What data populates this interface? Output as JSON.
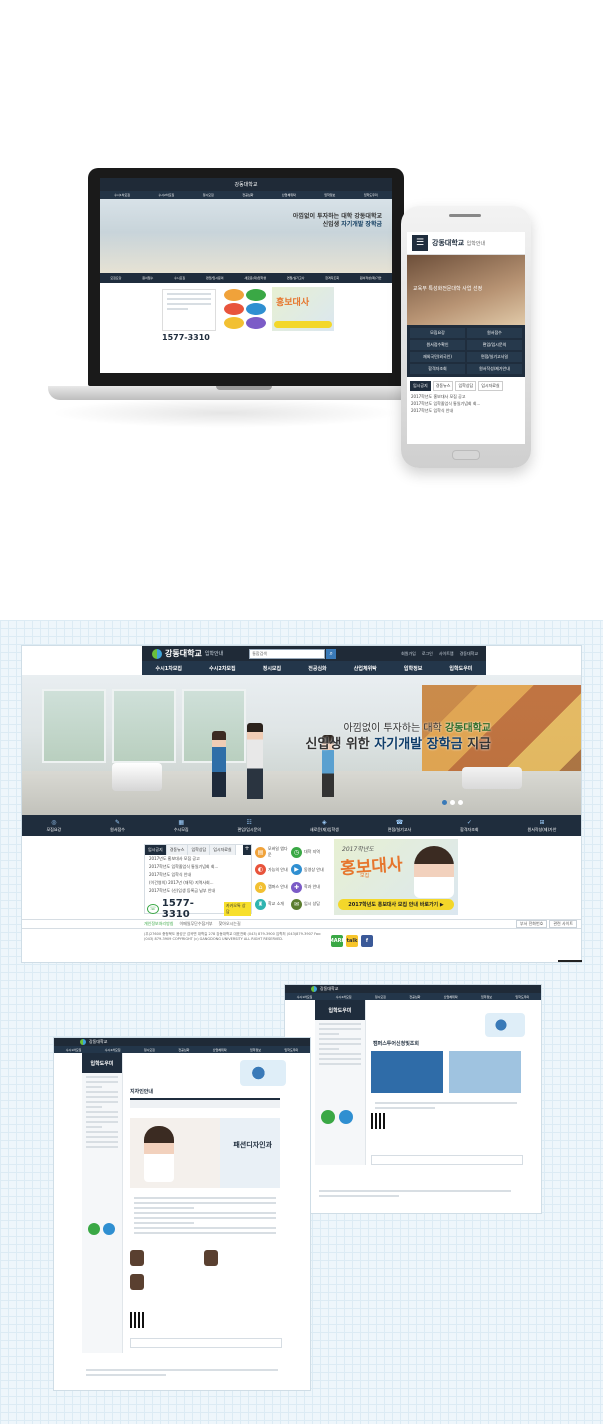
{
  "brand": {
    "name": "강동대학교",
    "sub": "입학안내"
  },
  "search": {
    "placeholder": "통합검색"
  },
  "util_links": [
    "회원가입",
    "로그인",
    "사이트맵",
    "경동대학교"
  ],
  "menu": [
    "수시1차모집",
    "수시2차모집",
    "정시모집",
    "전공심화",
    "산업체위탁",
    "입학정보",
    "입학도우미"
  ],
  "hero": {
    "line1_prefix": "아낌없이 투자하는 대학",
    "line1_highlight": "강동대학교",
    "line2_prefix": "신입생",
    "line2_mid": "위한",
    "line2_highlight": "자기개발 장학금",
    "line2_suffix": "지급"
  },
  "tiles": [
    {
      "icon": "◎",
      "label": "모집요강"
    },
    {
      "icon": "✎",
      "label": "원서접수"
    },
    {
      "icon": "▦",
      "label": "수시모집"
    },
    {
      "icon": "☷",
      "label": "편입/입시문의"
    },
    {
      "icon": "◈",
      "label": "새로운(재)입학생"
    },
    {
      "icon": "☎",
      "label": "면접/실기고사"
    },
    {
      "icon": "✓",
      "label": "합격자조회"
    },
    {
      "icon": "⊞",
      "label": "원서작성(제)가안"
    }
  ],
  "news": {
    "tabs": [
      "입시공지",
      "경동뉴스",
      "입학상담",
      "입시자료실"
    ],
    "items": [
      "2017년도 홍보대사 모집 공고",
      "2017학년도 입학졸업식 통일기념회 회...",
      "2017학년도 입학식 안내",
      "(이건영의) 2017년 (재직) 지역사회...",
      "2017학년도 (신)입생 등록금 납부 안내"
    ],
    "more": "+"
  },
  "phone": {
    "number": "1577-3310",
    "kakao": "카카오톡 상담"
  },
  "quick": [
    {
      "label": "모바일 앱다운",
      "color": "#f0a23a",
      "icon": "▤"
    },
    {
      "label": "대학 지역",
      "color": "#3aa845",
      "icon": "◷"
    },
    {
      "label": "가능의 안내",
      "color": "#e8543c",
      "icon": "◐"
    },
    {
      "label": "동영상 안내",
      "color": "#2f8fd1",
      "icon": "▶"
    },
    {
      "label": "캠퍼스 안내",
      "color": "#f2c032",
      "icon": "⌂"
    },
    {
      "label": "학과 안내",
      "color": "#7b5bc7",
      "icon": "✚"
    },
    {
      "label": "학교 소개",
      "color": "#2fb4b0",
      "icon": "♜"
    },
    {
      "label": "입시 상담",
      "color": "#5b7d2f",
      "icon": "✉"
    }
  ],
  "banner": {
    "year": "2017학년도",
    "title": "홍보대사",
    "subtitle": "모집",
    "cta": "2017학년도 홍보대사 모집 안내 바로가기 ▶"
  },
  "footer": {
    "links": [
      "개인정보처리방침",
      "이메일무단수집거부",
      "찾아오시는길"
    ],
    "select1": "부서 전화번호",
    "select2": "관련 사이트",
    "address": "(우)27600 충청북도 음성군 감곡면 대학길 278 강동대학교 대표전화 (043) 879-3900 입학처 (043)879-3907 Fax: (043) 879-3909  COPYRIGHT (c) GANGDONG UNIVERSITY ALL RIGHT RESERVED."
  },
  "footer_icons": [
    {
      "label": "MARK",
      "color": "#3aa845"
    },
    {
      "label": "talk",
      "color": "#f7c52a"
    },
    {
      "label": "f",
      "color": "#3b5998"
    }
  ],
  "mobile": {
    "hero_text": "교육부 특성화전문대학 사업 선정",
    "grid": [
      "모집요강",
      "원서접수",
      "원서접수확인",
      "편입/입시문의",
      "재외국민(외국인)",
      "면접/실기고사일",
      "합격자조회",
      "원서작성/제가안내"
    ],
    "tabs": [
      "입시공지",
      "경동뉴스",
      "입학상담",
      "입시자료실"
    ],
    "news": [
      "2017학년도 홍보대사 모집 공고",
      "2017학년도 입학졸업식 통일기념회 회...",
      "2017학년도 입학식 안내"
    ]
  },
  "subpages": {
    "side_title": "입학도우미",
    "page_title": "지자인안내",
    "major": "패션디자인과",
    "section": "캠퍼스투어신청및조회"
  }
}
